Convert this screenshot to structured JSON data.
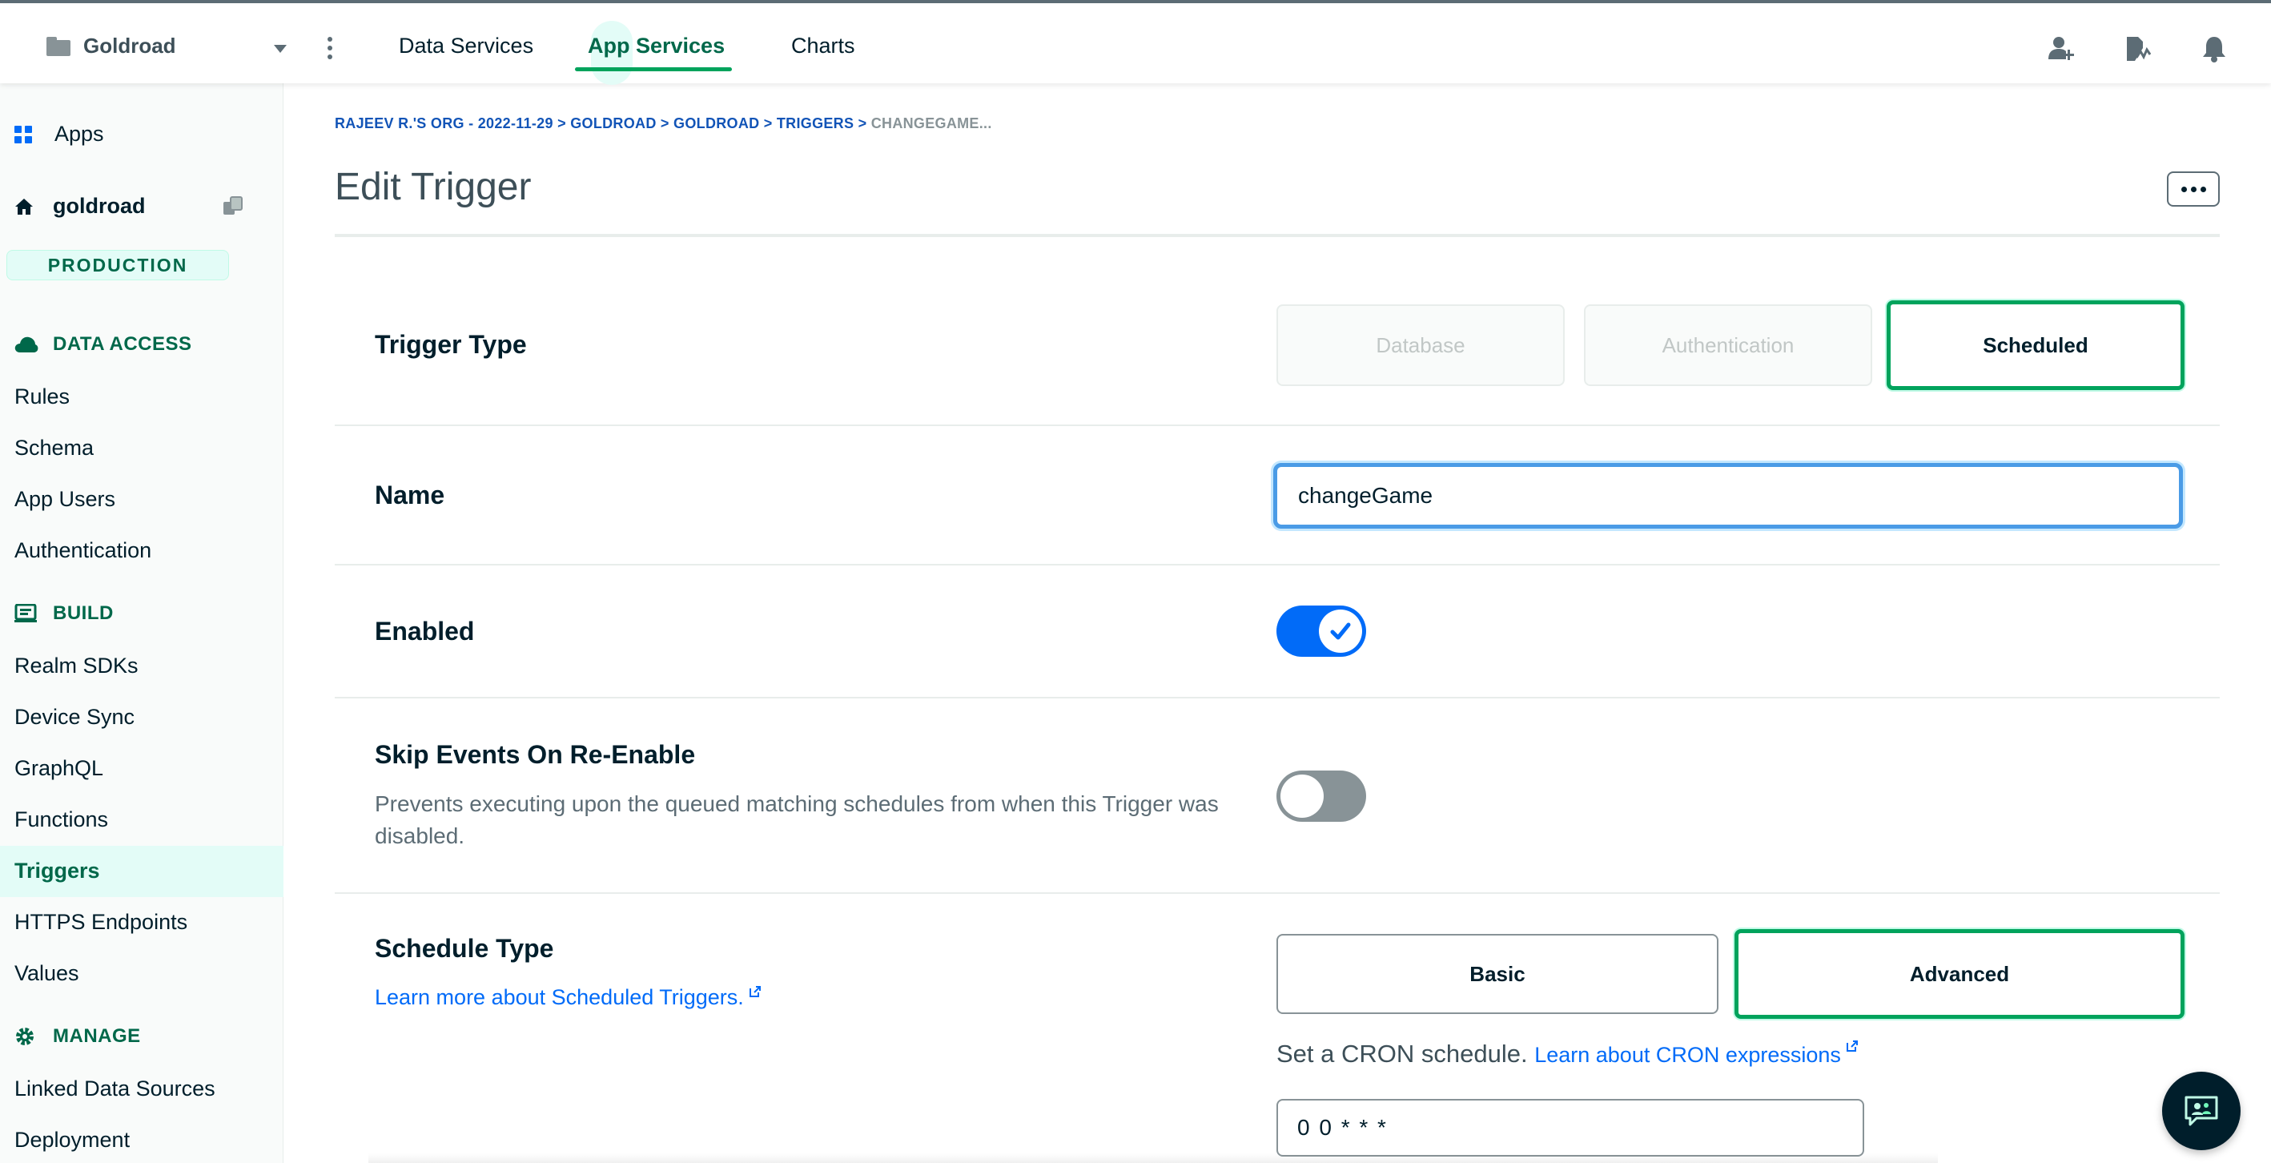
{
  "topbar": {
    "project_name": "Goldroad",
    "tabs": [
      {
        "label": "Data Services",
        "active": false
      },
      {
        "label": "App Services",
        "active": true
      },
      {
        "label": "Charts",
        "active": false
      }
    ],
    "icons": [
      "invite-user-icon",
      "activity-feed-icon",
      "bell-icon"
    ]
  },
  "sidebar": {
    "apps_label": "Apps",
    "app_name": "goldroad",
    "environment": "PRODUCTION",
    "sections": [
      {
        "title": "DATA ACCESS",
        "icon": "cloud-icon",
        "items": [
          "Rules",
          "Schema",
          "App Users",
          "Authentication"
        ]
      },
      {
        "title": "BUILD",
        "icon": "laptop-icon",
        "items": [
          "Realm SDKs",
          "Device Sync",
          "GraphQL",
          "Functions",
          "Triggers",
          "HTTPS Endpoints",
          "Values"
        ]
      },
      {
        "title": "MANAGE",
        "icon": "gear-icon",
        "items": [
          "Linked Data Sources",
          "Deployment"
        ]
      }
    ],
    "active_item": "Triggers"
  },
  "main": {
    "breadcrumb": {
      "parts": [
        "RAJEEV R.'S ORG - 2022-11-29",
        "GOLDROAD",
        "GOLDROAD",
        "TRIGGERS"
      ],
      "separator": " > ",
      "current": "CHANGEGAME..."
    },
    "title": "Edit Trigger",
    "trigger_type": {
      "label": "Trigger Type",
      "options": [
        "Database",
        "Authentication",
        "Scheduled"
      ],
      "selected": "Scheduled"
    },
    "name": {
      "label": "Name",
      "value": "changeGame"
    },
    "enabled": {
      "label": "Enabled",
      "value": true
    },
    "skip_events": {
      "label": "Skip Events On Re-Enable",
      "description": "Prevents executing upon the queued matching schedules from when this Trigger was disabled.",
      "value": false
    },
    "schedule_type": {
      "label": "Schedule Type",
      "learn_more": "Learn more about Scheduled Triggers.",
      "options": [
        "Basic",
        "Advanced"
      ],
      "selected": "Advanced",
      "cron_caption": "Set a CRON schedule.",
      "cron_link": "Learn about CRON expressions",
      "cron_value": "0 0 * * *"
    }
  },
  "colors": {
    "brand_green": "#00684a",
    "accent_green": "#00a35c",
    "focus_blue": "#4a9be6",
    "toggle_on": "#016bf8",
    "toggle_off": "#889397"
  }
}
